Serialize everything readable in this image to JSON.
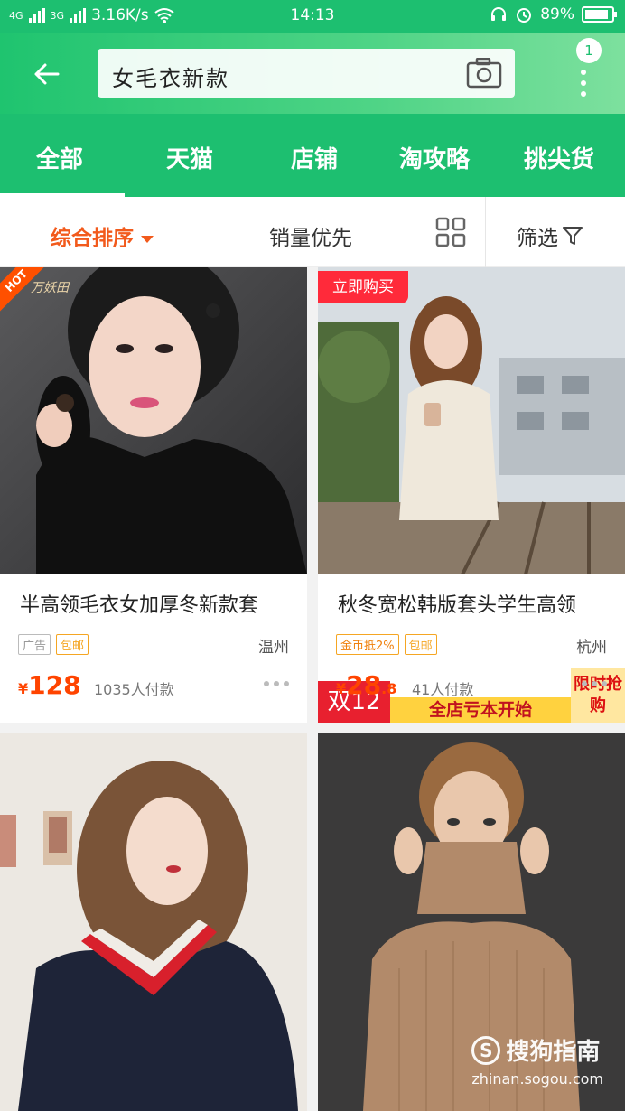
{
  "status_bar": {
    "network_left": "4G",
    "network_right": "3G",
    "speed": "3.16K/s",
    "time": "14:13",
    "battery_text": "89%",
    "battery_level": 0.89
  },
  "header": {
    "search_query": "女毛衣新款",
    "notification_count": "1"
  },
  "tabs": [
    "全部",
    "天猫",
    "店铺",
    "淘攻略",
    "挑尖货"
  ],
  "sortbar": {
    "default_sort": "综合排序",
    "sales_first": "销量优先",
    "filter": "筛选"
  },
  "products": [
    {
      "title": "半高领毛衣女加厚冬新款套",
      "tags": [
        "广告",
        "包邮"
      ],
      "location": "温州",
      "price_currency": "¥",
      "price_int": "128",
      "price_dec": "",
      "sales": "1035人付款",
      "badge": "HOT",
      "brand": "万妖田"
    },
    {
      "title": "秋冬宽松韩版套头学生高领",
      "tags": [
        "金币抵2%",
        "包邮"
      ],
      "location": "杭州",
      "price_currency": "¥",
      "price_int": "28",
      "price_dec": ".8",
      "sales": "41人付款",
      "badge": "立即购买",
      "promo_left": "双12",
      "promo_mid": "全店亏本开始",
      "promo_right": "限时抢购"
    },
    {},
    {}
  ],
  "watermark": {
    "main": "搜狗指南",
    "sub": "zhinan.sogou.com"
  },
  "colors": {
    "brand_green": "#1dbf70",
    "accent_orange": "#f25a1c",
    "price_red": "#ff4400"
  }
}
